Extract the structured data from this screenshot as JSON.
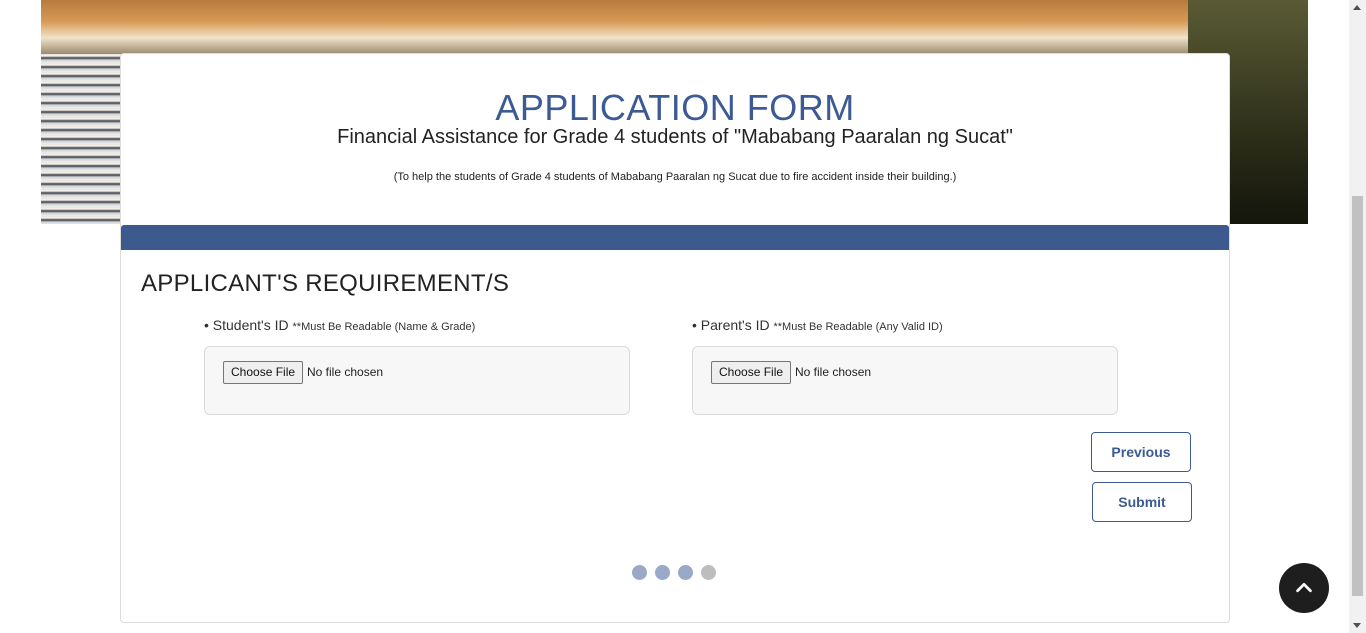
{
  "header": {
    "title": "APPLICATION FORM",
    "subtitle": "Financial Assistance for Grade 4 students of \"Mababang Paaralan ng Sucat\"",
    "note": "(To help the students of Grade 4 students of Mababang Paaralan ng Sucat due to fire accident inside their building.)"
  },
  "section": {
    "title": "APPLICANT'S REQUIREMENT/S"
  },
  "fields": {
    "student_id": {
      "label": "• Student's ID",
      "hint": "**Must Be Readable (Name & Grade)",
      "button": "Choose File",
      "status": "No file chosen"
    },
    "parent_id": {
      "label": "• Parent's ID",
      "hint": "**Must Be Readable (Any Valid ID)",
      "button": "Choose File",
      "status": "No file chosen"
    }
  },
  "actions": {
    "previous": "Previous",
    "submit": "Submit"
  },
  "progress": {
    "total_steps": 4,
    "completed_steps": 3
  },
  "colors": {
    "accent": "#3c5a94",
    "bar": "#3d5a8f",
    "dot_active": "#9aa9c8",
    "dot_inactive": "#bdbdbd"
  },
  "icons": {
    "back_to_top": "chevron-up-icon"
  }
}
